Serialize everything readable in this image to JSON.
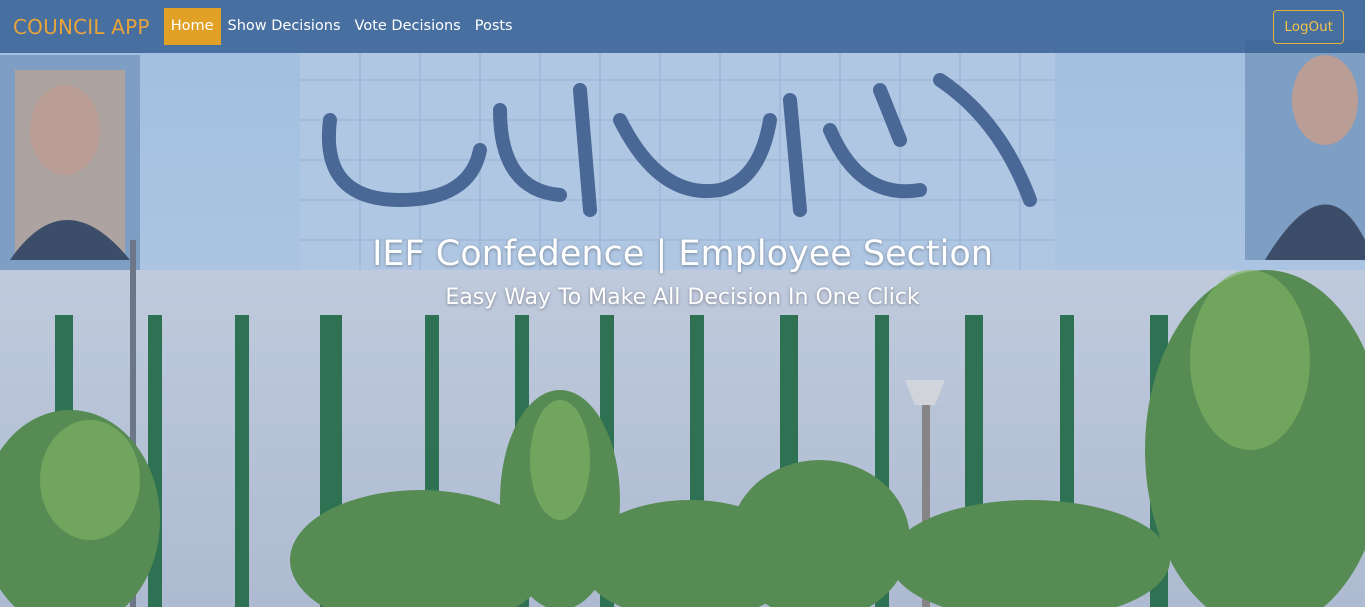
{
  "navbar": {
    "brand": "COUNCIL APP",
    "items": [
      {
        "label": "Home",
        "active": true
      },
      {
        "label": "Show Decisions",
        "active": false
      },
      {
        "label": "Vote Decisions",
        "active": false
      },
      {
        "label": "Posts",
        "active": false
      }
    ],
    "logout_label": "LogOut"
  },
  "hero": {
    "title": "IEF Confedence | Employee Section",
    "subtitle": "Easy Way To Make All Decision In One Click"
  },
  "colors": {
    "accent": "#e0a126",
    "navbar": "#3a6496",
    "brand": "#e8a33a"
  }
}
